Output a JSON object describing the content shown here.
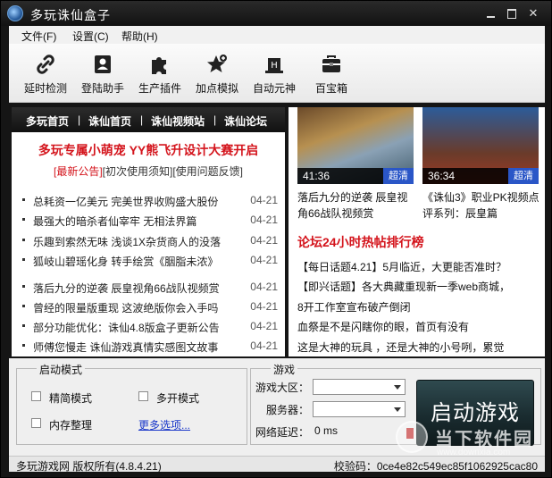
{
  "app": {
    "title": "多玩诛仙盒子"
  },
  "menu": {
    "items": [
      "文件(F)",
      "设置(C)",
      "帮助(H)"
    ]
  },
  "toolbar": {
    "tools": [
      {
        "label": "延时检测",
        "icon": "link-icon"
      },
      {
        "label": "登陆助手",
        "icon": "id-card-icon"
      },
      {
        "label": "生产插件",
        "icon": "puzzle-icon"
      },
      {
        "label": "加点模拟",
        "icon": "star-plus-icon"
      },
      {
        "label": "自动元神",
        "icon": "hat-icon"
      },
      {
        "label": "百宝箱",
        "icon": "toolbox-icon"
      }
    ]
  },
  "nav": {
    "links": [
      "多玩首页",
      "诛仙首页",
      "诛仙视频站",
      "诛仙论坛"
    ],
    "separator": "|"
  },
  "promo": {
    "headline": "多玩专属小萌宠 YY熊飞升设计大赛开启"
  },
  "notices": {
    "items": [
      "[最新公告]",
      "[初次使用须知]",
      "[使用问题反馈]"
    ]
  },
  "news": [
    {
      "title": "总耗资一亿美元 完美世界收购盛大股份",
      "date": "04-21"
    },
    {
      "title": "最强大的暗杀者仙宰牢 无相法界篇",
      "date": "04-21"
    },
    {
      "title": "乐趣到索然无味 浅谈1X杂货商人的没落",
      "date": "04-21"
    },
    {
      "title": "狐岐山碧瑶化身 转手绘赏《胭脂未浓》",
      "date": "04-21"
    },
    {
      "title": "落后九分的逆袭 辰皇视角66战队视频赏",
      "date": "04-21"
    },
    {
      "title": "曾经的限量版重现 这波绝版你会入手吗",
      "date": "04-21"
    },
    {
      "title": "部分功能优化：诛仙4.8版盒子更新公告",
      "date": "04-21"
    },
    {
      "title": "师傅您慢走 诛仙游戏真情实感图文故事",
      "date": "04-21"
    }
  ],
  "videos": [
    {
      "duration": "41:36",
      "badge": "超清",
      "title": "落后九分的逆袭 辰皇视角66战队视频赏"
    },
    {
      "duration": "36:34",
      "badge": "超清",
      "title": "《诛仙3》职业PK视频点评系列：辰皇篇"
    }
  ],
  "forum": {
    "heading": "论坛24小时热帖排行榜",
    "posts": [
      "【每日话题4.21】5月临近，大更能否准时？",
      "【即兴话题】各大典藏重现新一季web商城，",
      "8开工作室宣布破产倒闭",
      "血祭是不是闪瞎你的眼，首页有没有",
      "这是大神的玩具 ，还是大神的小号咧，累觉"
    ]
  },
  "launch_mode": {
    "title": "启动模式",
    "options": [
      {
        "label": "精简模式",
        "checked": false
      },
      {
        "label": "多开模式",
        "checked": false
      },
      {
        "label": "内存整理",
        "checked": false
      }
    ],
    "more_link": "更多选项..."
  },
  "game": {
    "title": "游戏",
    "region_label": "游戏大区：",
    "region_value": "",
    "server_label": "服务器：",
    "server_value": "",
    "latency_label": "网络延迟：",
    "latency_value": "0 ms",
    "launch_label": "启动游戏"
  },
  "status": {
    "copyright": "多玩游戏网 版权所有(4.8.4.21)",
    "checksum": "校验码：0ce4e82c549ec85f1062925cac80"
  },
  "watermark": {
    "text": "当下软件园",
    "url": "www.downxia.com"
  },
  "colors": {
    "accent_red": "#d4141c",
    "link_blue": "#1a37c9",
    "hd_badge": "#2a56c7"
  }
}
